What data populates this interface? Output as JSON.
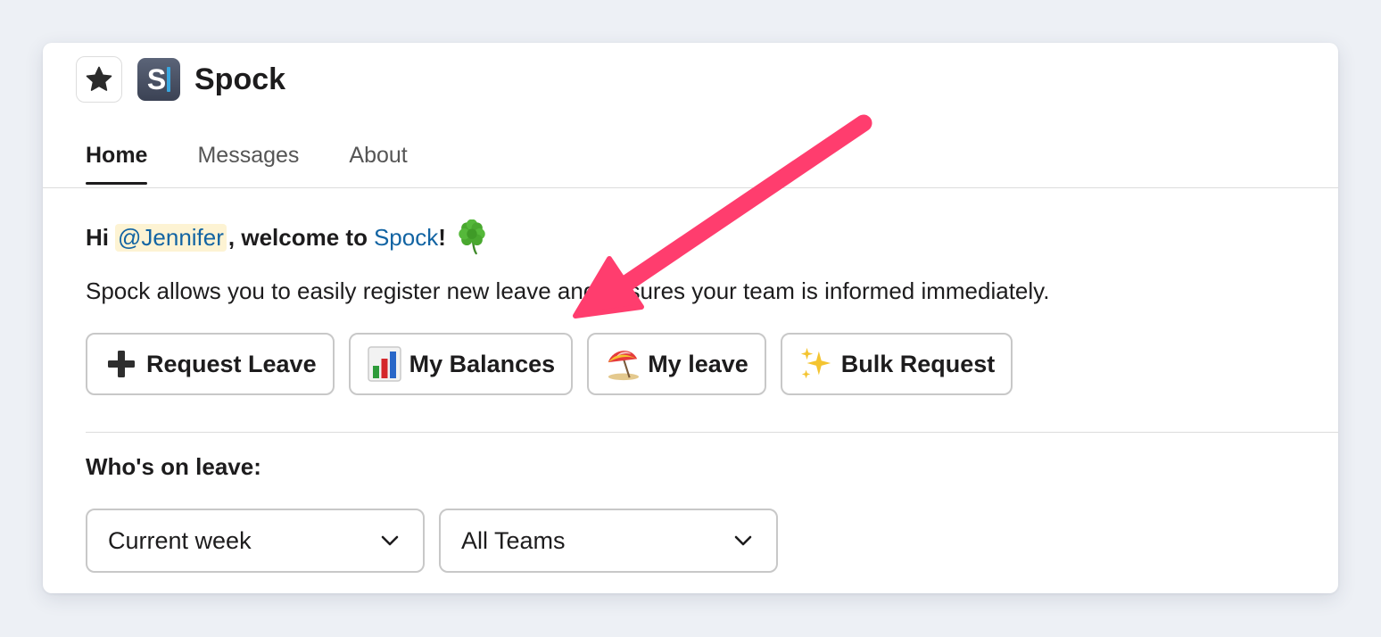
{
  "app": {
    "name": "Spock",
    "logo_letter": "S"
  },
  "tabs": [
    {
      "label": "Home",
      "active": true
    },
    {
      "label": "Messages",
      "active": false
    },
    {
      "label": "About",
      "active": false
    }
  ],
  "greeting": {
    "prefix": "Hi",
    "mention": "@Jennifer",
    "middle": ", welcome to",
    "app_link": "Spock",
    "suffix": "!",
    "emoji": "clover-icon"
  },
  "description": "Spock allows you to easily register new leave and ensures your team is informed immediately.",
  "actions": [
    {
      "label": "Request Leave",
      "icon": "plus-icon"
    },
    {
      "label": "My Balances",
      "icon": "bar-chart-icon"
    },
    {
      "label": "My leave",
      "icon": "beach-umbrella-icon"
    },
    {
      "label": "Bulk Request",
      "icon": "sparkles-icon"
    }
  ],
  "whos_on_leave": {
    "title": "Who's on leave:",
    "period_select": "Current week",
    "team_select": "All Teams"
  },
  "colors": {
    "link": "#1264a3",
    "mention_bg": "#fdf3d3",
    "annotation_arrow": "#ff3d6e"
  }
}
